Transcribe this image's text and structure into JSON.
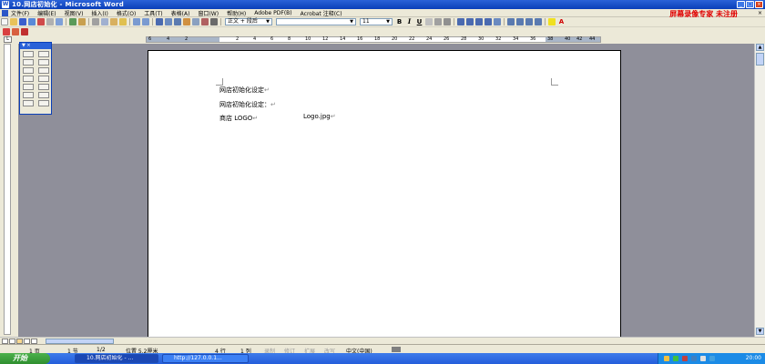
{
  "window": {
    "title": "10.网店初始化 - Microsoft Word"
  },
  "menu": {
    "items": [
      "文件(F)",
      "编辑(E)",
      "视图(V)",
      "插入(I)",
      "格式(O)",
      "工具(T)",
      "表格(A)",
      "窗口(W)",
      "帮助(H)",
      "Adobe PDF(B)",
      "Acrobat 注释(C)"
    ],
    "promo": "屏幕录像专家 未注册",
    "close_doc": "×"
  },
  "toolbar": {
    "style_value": "正文 + 段后",
    "font_size": "11",
    "bold": "B",
    "italic": "I",
    "underline": "U",
    "font_color_glyph": "A"
  },
  "ruler": {
    "ticks": [
      "6",
      "4",
      "2",
      "2",
      "4",
      "6",
      "8",
      "10",
      "12",
      "14",
      "16",
      "18",
      "20",
      "22",
      "24",
      "26",
      "28",
      "30",
      "32",
      "34",
      "36",
      "38",
      "40",
      "42",
      "44"
    ]
  },
  "document": {
    "lines": [
      {
        "text": "网店初始化设定"
      },
      {
        "text": "网店初始化设定："
      },
      {
        "label": "商店 LOGO",
        "value": "Logo.jpg"
      }
    ],
    "paragraph_mark": "↵"
  },
  "status": {
    "page": "1 页",
    "section": "1 节",
    "page_of": "1/2",
    "position": "位置 5.2厘米",
    "line": "4 行",
    "column": "1 列",
    "rec": "录制",
    "trk": "修订",
    "ext": "扩展",
    "ovr": "改写",
    "language": "中文(中国)"
  },
  "taskbar": {
    "start": "开始",
    "tasks": [
      "10.网店初始化 - ...",
      "http://127.0.0.1..."
    ],
    "clock": "20:00"
  }
}
